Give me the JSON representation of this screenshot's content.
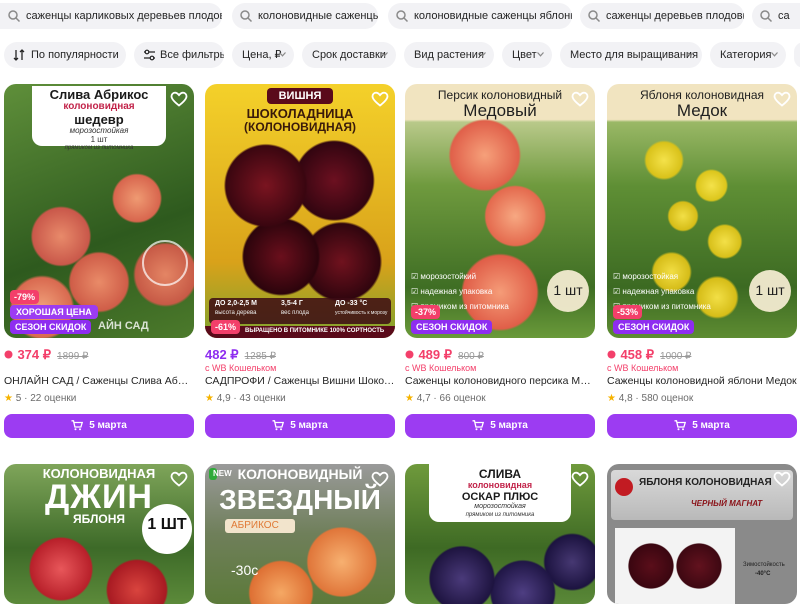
{
  "search_chips": [
    "саженцы карликовых деревьев плодовых",
    "колоновидные саженцы",
    "колоновидные саженцы яблони",
    "саженцы деревьев плодовых",
    "са"
  ],
  "filters": [
    "По популярности",
    "Все фильтры",
    "Цена, ₽",
    "Срок доставки",
    "Вид растения",
    "Цвет",
    "Место для выращивания",
    "Категория"
  ],
  "products": [
    {
      "img_lines": [
        "Слива Абрикос",
        "колоновидная",
        "шедевр",
        "морозостойкая",
        "1 шт",
        "прямиком из питомника"
      ],
      "badges": {
        "discount": "-79%",
        "promo": "ХОРОШАЯ ЦЕНА",
        "season": "СЕЗОН СКИДОК"
      },
      "img_extra": "АЙН САД",
      "price": "374 ₽",
      "old_price": "1899 ₽",
      "wb": "",
      "name": "ОНЛАЙН САД / Саженцы Слива Абрикос",
      "rating": "5",
      "reviews": "22 оценки",
      "buy": "5 марта"
    },
    {
      "img_lines": [
        "ВИШНЯ",
        "ШОКОЛАДНИЦА",
        "(КОЛОНОВИДНАЯ)"
      ],
      "badges": {
        "discount": "-61%",
        "promo": "",
        "season": ""
      },
      "img_extra": "ВЫРАЩЕНО В ПИТОМНИКЕ 100% СОРТНОСТЬ",
      "specs": [
        "ДО 2,0-2,5 М",
        "высота дерева",
        "3,5-4 Г",
        "вес плода",
        "ДО -33 °С",
        "устойчивость к морозу"
      ],
      "price": "482 ₽",
      "old_price": "1285 ₽",
      "wb": "с WB Кошельком",
      "name": "САДПРОФИ / Саженцы Вишни Шоколадница",
      "rating": "4,9",
      "reviews": "43 оценки",
      "buy": "5 марта"
    },
    {
      "img_lines": [
        "Персик колоновидный",
        "Медовый"
      ],
      "badges": {
        "discount": "-37%",
        "promo": "",
        "season": "СЕЗОН СКИДОК"
      },
      "img_extra": "1 шт",
      "checks": [
        "морозостойкий",
        "надежная упаковка",
        "прямиком из питомника"
      ],
      "price": "489 ₽",
      "old_price": "800 ₽",
      "wb": "с WB Кошельком",
      "name": "Саженцы колоновидного персика Медовый",
      "rating": "4,7",
      "reviews": "66 оценок",
      "buy": "5 марта"
    },
    {
      "img_lines": [
        "Яблоня колоновидная",
        "Медок"
      ],
      "badges": {
        "discount": "-53%",
        "promo": "",
        "season": "СЕЗОН СКИДОК"
      },
      "img_extra": "1 шт",
      "checks": [
        "морозостойкая",
        "надежная упаковка",
        "прямиком из питомника"
      ],
      "price": "458 ₽",
      "old_price": "1000 ₽",
      "wb": "с WB Кошельком",
      "name": "Саженцы колоновидной яблони Медок",
      "rating": "4,8",
      "reviews": "580 оценок",
      "buy": "5 марта"
    },
    {
      "img_lines": [
        "КОЛОНОВИДНАЯ",
        "ДЖИН",
        "ЯБЛОНЯ",
        "1 ШТ"
      ]
    },
    {
      "img_lines": [
        "NEW",
        "КОЛОНОВИДНЫЙ",
        "ЗВЕЗДНЫЙ",
        "АБРИКОС",
        "-30с"
      ]
    },
    {
      "img_lines": [
        "СЛИВА",
        "колоновидная",
        "ОСКАР ПЛЮС",
        "морозостойкая",
        "прямиком из питомника"
      ]
    },
    {
      "img_lines": [
        "ЯБЛОНЯ КОЛОНОВИДНАЯ",
        "ЧЕРНЫЙ МАГНАТ",
        "Зимостойкость",
        "-40°C"
      ]
    }
  ]
}
